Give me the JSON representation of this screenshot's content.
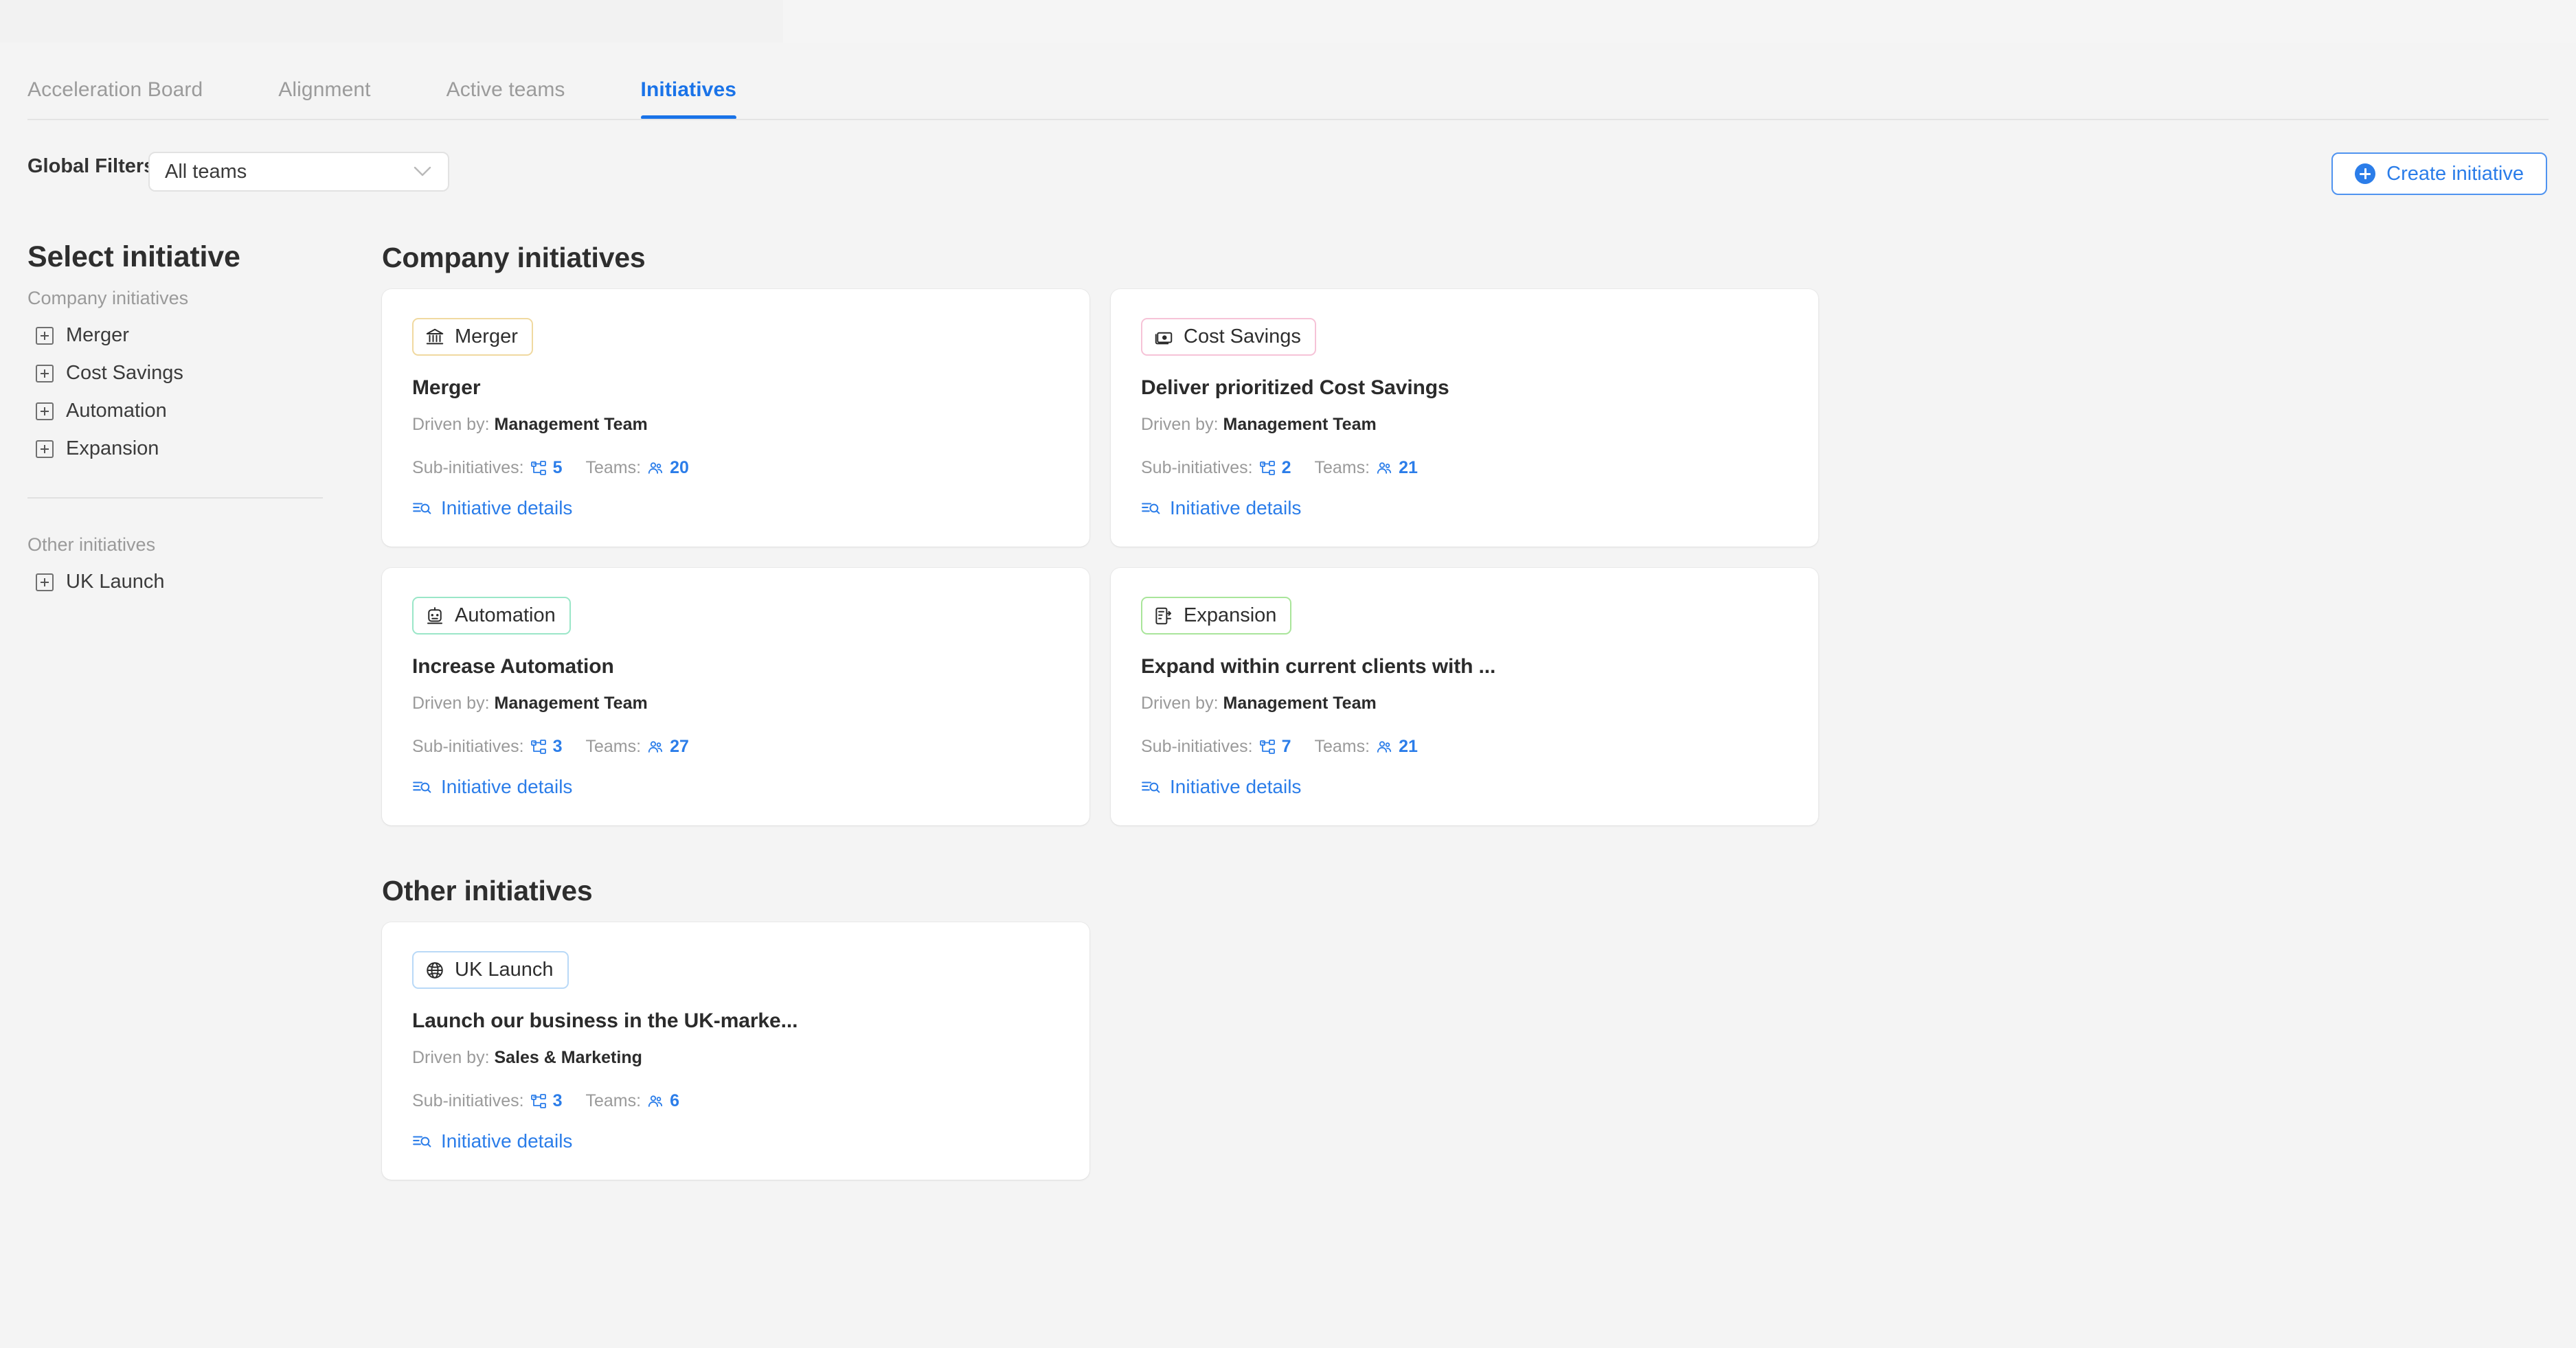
{
  "tabs": [
    {
      "label": "Acceleration Board",
      "active": false
    },
    {
      "label": "Alignment",
      "active": false
    },
    {
      "label": "Active teams",
      "active": false
    },
    {
      "label": "Initiatives",
      "active": true
    }
  ],
  "filters": {
    "label": "Global Filters",
    "select_value": "All teams",
    "select_placeholder": "All teams"
  },
  "create_button": {
    "label": "Create initiative",
    "icon": "plus-circle-icon"
  },
  "sidebar": {
    "title": "Select initiative",
    "groups": [
      {
        "label": "Company initiatives",
        "items": [
          {
            "label": "Merger"
          },
          {
            "label": "Cost Savings"
          },
          {
            "label": "Automation"
          },
          {
            "label": "Expansion"
          }
        ]
      },
      {
        "label": "Other initiatives",
        "items": [
          {
            "label": "UK Launch"
          }
        ]
      }
    ]
  },
  "main": {
    "sections": [
      {
        "title": "Company initiatives",
        "cards": [
          {
            "tag": "Merger",
            "tag_icon": "bank-icon",
            "tag_border_color": "#f0d9a0",
            "title": "Merger",
            "driven_by_label": "Driven by:",
            "driven_by": "Management Team",
            "sub_label": "Sub-initiatives:",
            "sub_count": "5",
            "teams_label": "Teams:",
            "teams_count": "20",
            "details_label": "Initiative details"
          },
          {
            "tag": "Cost Savings",
            "tag_icon": "money-icon",
            "tag_border_color": "#f6c3d7",
            "title": "Deliver prioritized Cost Savings",
            "driven_by_label": "Driven by:",
            "driven_by": "Management Team",
            "sub_label": "Sub-initiatives:",
            "sub_count": "2",
            "teams_label": "Teams:",
            "teams_count": "21",
            "details_label": "Initiative details"
          },
          {
            "tag": "Automation",
            "tag_icon": "robot-icon",
            "tag_border_color": "#9ae6c8",
            "title": "Increase Automation",
            "driven_by_label": "Driven by:",
            "driven_by": "Management Team",
            "sub_label": "Sub-initiatives:",
            "sub_count": "3",
            "teams_label": "Teams:",
            "teams_count": "27",
            "details_label": "Initiative details"
          },
          {
            "tag": "Expansion",
            "tag_icon": "expansion-icon",
            "tag_border_color": "#a9e59a",
            "title": "Expand within current clients with ...",
            "driven_by_label": "Driven by:",
            "driven_by": "Management Team",
            "sub_label": "Sub-initiatives:",
            "sub_count": "7",
            "teams_label": "Teams:",
            "teams_count": "21",
            "details_label": "Initiative details"
          }
        ]
      },
      {
        "title": "Other initiatives",
        "cards": [
          {
            "tag": "UK Launch",
            "tag_icon": "globe-icon",
            "tag_border_color": "#b9d9f7",
            "title": "Launch our business in the UK-marke...",
            "driven_by_label": "Driven by:",
            "driven_by": "Sales & Marketing",
            "sub_label": "Sub-initiatives:",
            "sub_count": "3",
            "teams_label": "Teams:",
            "teams_count": "6",
            "details_label": "Initiative details"
          }
        ]
      }
    ]
  },
  "colors": {
    "accent_blue": "#2b7de9",
    "page_bg": "#f4f4f4",
    "card_bg": "#ffffff",
    "muted_text": "#9a9a9a"
  }
}
